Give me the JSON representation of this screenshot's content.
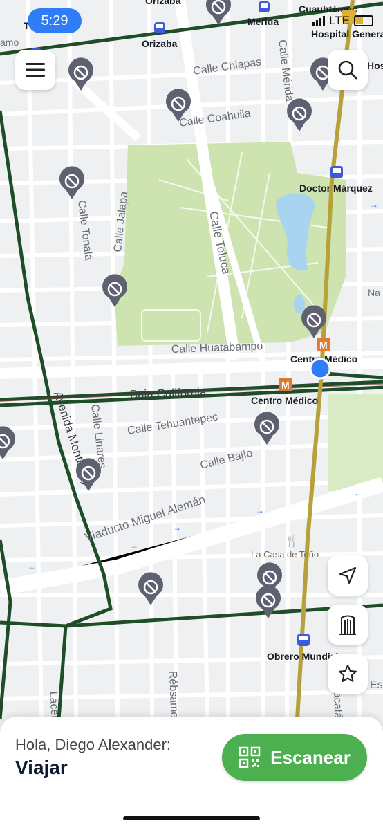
{
  "status_bar": {
    "time": "5:29",
    "network": "LTE"
  },
  "map": {
    "streets": [
      {
        "id": "calle-chiapas",
        "label": "Calle Chiapas"
      },
      {
        "id": "calle-coahuila",
        "label": "Calle Coahuila"
      },
      {
        "id": "calle-merida",
        "label": "Calle Mérida"
      },
      {
        "id": "calle-tonala",
        "label": "Calle Tonalá"
      },
      {
        "id": "calle-jalapa",
        "label": "Calle Jalapa"
      },
      {
        "id": "calle-toluca",
        "label": "Calle Toluca"
      },
      {
        "id": "calle-huatabampo",
        "label": "Calle Huatabampo"
      },
      {
        "id": "baja-california",
        "label": "Baja California"
      },
      {
        "id": "avenida-monterrey",
        "label": "Avenida Monterrey"
      },
      {
        "id": "calle-linares",
        "label": "Calle Linares"
      },
      {
        "id": "calle-tehuantepec",
        "label": "Calle Tehuantepec"
      },
      {
        "id": "calle-bajio",
        "label": "Calle Bajío"
      },
      {
        "id": "viaducto",
        "label": "Viaducto Miguel Alemán"
      },
      {
        "id": "rebsamen",
        "label": "Rébsamen"
      },
      {
        "id": "lacera",
        "label": "Lacera"
      },
      {
        "id": "acatan",
        "label": "acatá"
      },
      {
        "id": "es",
        "label": "Es"
      }
    ],
    "stations": [
      {
        "id": "orizaba-top",
        "label": "Orizaba"
      },
      {
        "id": "orizaba",
        "label": "Orizaba"
      },
      {
        "id": "merida",
        "label": "Mérida"
      },
      {
        "id": "cuauhtemoc",
        "label": "Cuauhtémoc"
      },
      {
        "id": "hospital-general",
        "label": "Hospital Genera"
      },
      {
        "id": "hos",
        "label": "Hos"
      },
      {
        "id": "doctor-marquez",
        "label": "Doctor Márquez"
      },
      {
        "id": "centro-medico-1",
        "label": "Centro Médico"
      },
      {
        "id": "centro-medico-2",
        "label": "Centro Médico"
      },
      {
        "id": "obrero-mundial",
        "label": "Obrero Mundial"
      },
      {
        "id": "na",
        "label": "Na"
      },
      {
        "id": "t",
        "label": "T"
      },
      {
        "id": "amo",
        "label": "amo"
      }
    ],
    "places": [
      {
        "id": "la-casa-de-tono",
        "label": "La Casa de Toño"
      }
    ],
    "no_parking_marker_count": 14
  },
  "buttons": {
    "menu": "menu-icon",
    "search": "search-icon",
    "locate": "navigation-arrow-icon",
    "transit": "metro-station-icon",
    "favorites": "star-icon"
  },
  "bottom_sheet": {
    "greeting": "Hola, Diego Alexander:",
    "action": "Viajar",
    "scan_button_label": "Escanear"
  },
  "colors": {
    "map_bg": "#eef0f2",
    "park": "#cde4b0",
    "water": "#a9d4f0",
    "route_green": "#1f4d28",
    "metro_gold": "#b8a13a",
    "marker": "#5f6170",
    "scan_button": "#4caf50",
    "location_dot": "#2f7df6"
  }
}
